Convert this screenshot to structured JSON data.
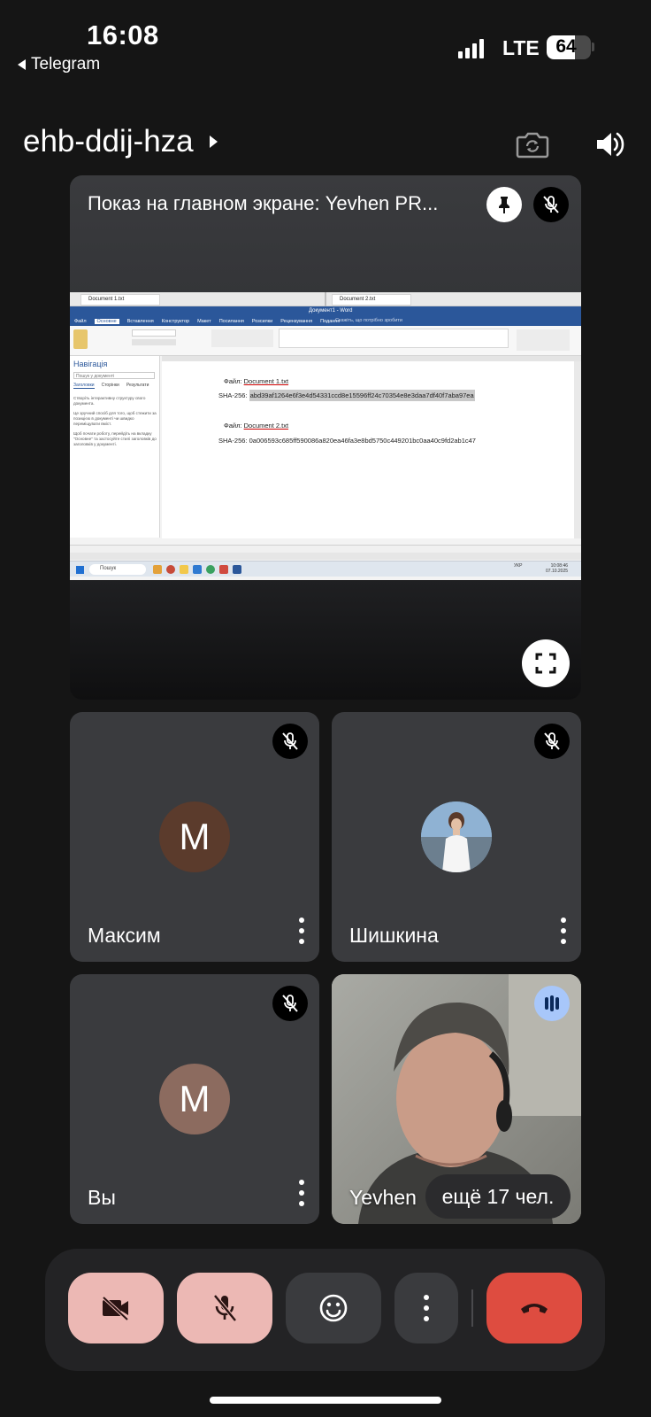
{
  "status_bar": {
    "time": "16:08",
    "back_app": "Telegram",
    "network": "LTE",
    "battery": "64",
    "battery_level": 0.64
  },
  "header": {
    "meeting_code": "ehb-ddij-hza",
    "icons": [
      "flip-camera-icon",
      "speaker-icon"
    ]
  },
  "presentation": {
    "label": "Показ на главном экране: Yevhen PR...",
    "shared_screen": {
      "window_left_tab": "Document 1.txt",
      "window_right_tab": "Document 2.txt",
      "app_title": "Документ1 - Word",
      "ribbon_tabs": [
        "Файл",
        "Основне",
        "Вставлення",
        "Конструктор",
        "Макет",
        "Посилання",
        "Розсилки",
        "Рецензування",
        "Подання"
      ],
      "search_hint": "Скажіть, що потрібно зробити",
      "nav_title": "Навігація",
      "nav_search_placeholder": "Пошук у документі",
      "nav_tabs": [
        "Заголовки",
        "Сторінки",
        "Результати"
      ],
      "nav_paragraphs": [
        "Створіть інтерактивну структуру свого документа.",
        "Це зручний спосіб для того, щоб стежити за позицією в документі чи швидко переміщувати вміст.",
        "Щоб почати роботу, перейдіть на вкладку \"Основне\" та застосуйте стилі заголовків до заголовків у документі."
      ],
      "file1_label": "Файл: ",
      "file1_name": "Document 1.txt",
      "hash1_label": "SHA-256: ",
      "hash1_value": "abd39af1264e6f3e4d54331ccd8e15596ff24c70354e8e3daa7df40f7aba97ea",
      "file2_label": "Файл: ",
      "file2_name": "Document 2.txt",
      "hash2_label": "SHA-256: ",
      "hash2_value": "0a006593c685ff590086a820ea46fa3e8bd5750c449201bc0aa40c9fd2ab1c47",
      "taskbar_search": "Пошук",
      "clock_time": "10:08:46",
      "clock_date": "07.10.2025",
      "lang": "УКР"
    }
  },
  "participants": [
    {
      "name": "Максим",
      "initial": "M",
      "avatar_color": "#5b3b2c",
      "muted": true
    },
    {
      "name": "Шишкина",
      "initial": "",
      "avatar_color": "#7fa6c9",
      "muted": true
    },
    {
      "name": "Вы",
      "initial": "M",
      "avatar_color": "#8c6b5f",
      "muted": true
    },
    {
      "name": "Yevhen",
      "initial": "",
      "speaking": true,
      "more_label": "ещё 17 чел."
    }
  ],
  "controls": {
    "camera_off_color": "#ecb8b4",
    "mic_off_color": "#ecb8b4",
    "end_call_color": "#de4c40",
    "buttons": [
      "camera-off-icon",
      "mic-off-icon",
      "emoji-icon",
      "more-icon",
      "end-call-icon"
    ]
  }
}
